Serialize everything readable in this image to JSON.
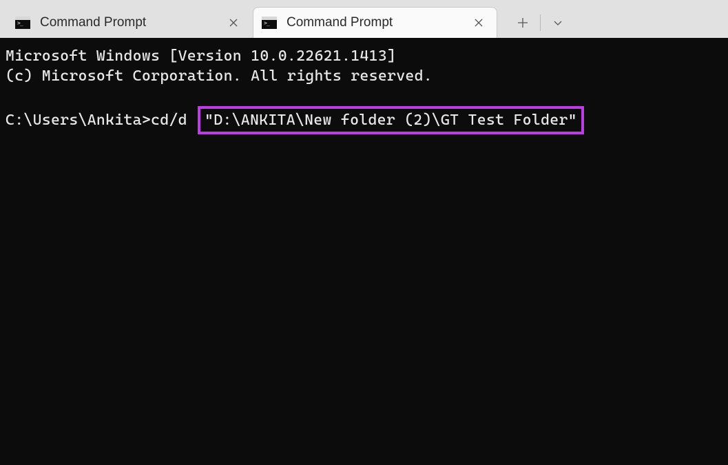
{
  "tabs": [
    {
      "title": "Command Prompt",
      "active": false
    },
    {
      "title": "Command Prompt",
      "active": true
    }
  ],
  "terminal": {
    "line1": "Microsoft Windows [Version 10.0.22621.1413]",
    "line2": "(c) Microsoft Corporation. All rights reserved.",
    "prompt": "C:\\Users\\Ankita>cd/d ",
    "highlighted": "\"D:\\ANKITA\\New folder (2)\\GT Test Folder\""
  }
}
